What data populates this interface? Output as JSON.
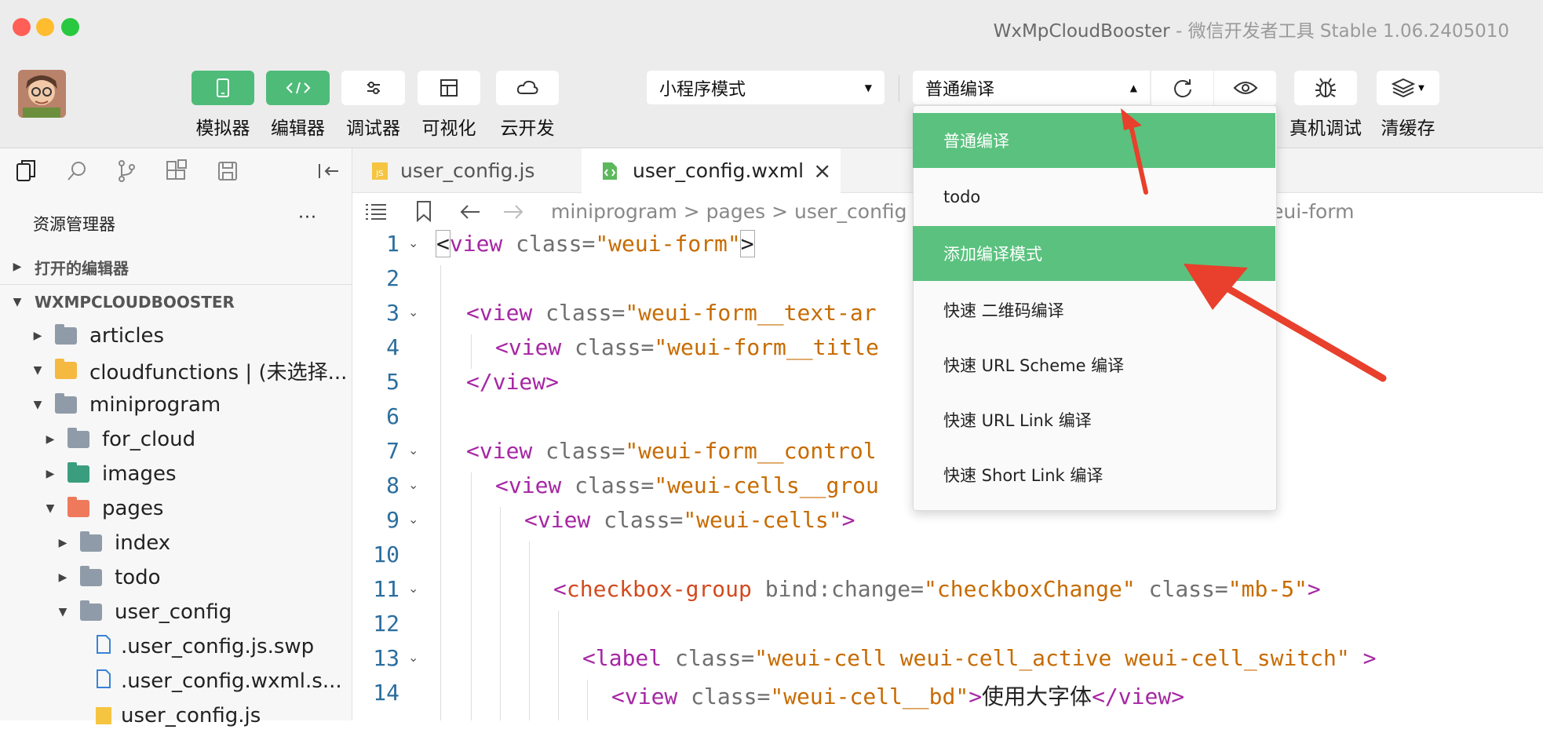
{
  "window": {
    "title": "WxMpCloudBooster",
    "subtitle": "微信开发者工具 Stable 1.06.2405010",
    "separator": "-"
  },
  "toolbar": {
    "buttons": [
      {
        "label": "模拟器",
        "icon": "phone-icon"
      },
      {
        "label": "编辑器",
        "icon": "code-icon"
      },
      {
        "label": "调试器",
        "icon": "sliders-icon"
      },
      {
        "label": "可视化",
        "icon": "layout-icon"
      },
      {
        "label": "云开发",
        "icon": "cloud-icon"
      }
    ],
    "mode_select": "小程序模式",
    "compile_select": "普通编译",
    "right_buttons": [
      {
        "label": "真机调试",
        "icon": "bug-icon"
      },
      {
        "label": "清缓存",
        "icon": "layers-icon"
      }
    ]
  },
  "dropdown": {
    "items": [
      "普通编译",
      "todo",
      "添加编译模式",
      "快速 二维码编译",
      "快速 URL Scheme 编译",
      "快速 URL Link 编译",
      "快速 Short Link 编译"
    ],
    "highlighted": [
      0,
      2
    ]
  },
  "sidebar": {
    "panel_title": "资源管理器",
    "more": "···",
    "open_editors": "打开的编辑器",
    "project": "WXMPCLOUDBOOSTER",
    "tree": [
      {
        "label": "articles"
      },
      {
        "label": "cloudfunctions | (未选择..."
      },
      {
        "label": "miniprogram"
      },
      {
        "label": "for_cloud"
      },
      {
        "label": "images"
      },
      {
        "label": "pages"
      },
      {
        "label": "index"
      },
      {
        "label": "todo"
      },
      {
        "label": "user_config"
      },
      {
        "label": ".user_config.js.swp"
      },
      {
        "label": ".user_config.wxml.s..."
      },
      {
        "label": "user_config.js"
      }
    ]
  },
  "tabs": [
    {
      "label": "user_config.js",
      "badge": "JS"
    },
    {
      "label": "user_config.wxml",
      "close": "×"
    }
  ],
  "breadcrumb": {
    "parts": [
      "miniprogram",
      "pages",
      "user_config"
    ],
    "sep": ">",
    "tail": "eui-form"
  },
  "code": {
    "lines": [
      "1",
      "2",
      "3",
      "4",
      "5",
      "6",
      "7",
      "8",
      "9",
      "10",
      "11",
      "12",
      "13",
      "14"
    ],
    "l1": {
      "open": "<",
      "tag": "view",
      "attr": " class=",
      "val": "\"weui-form\"",
      "close": ">"
    },
    "l3": {
      "open": "<",
      "tag": "view",
      "attr": " class=",
      "val": "\"weui-form__text-ar"
    },
    "l4": {
      "open": "<",
      "tag": "view",
      "attr": " class=",
      "val": "\"weui-form__title"
    },
    "l5": {
      "text": "</view>"
    },
    "l7": {
      "open": "<",
      "tag": "view",
      "attr": " class=",
      "val": "\"weui-form__control"
    },
    "l8": {
      "open": "<",
      "tag": "view",
      "attr": " class=",
      "val": "\"weui-cells__grou",
      "close": "\">"
    },
    "l9": {
      "open": "<",
      "tag": "view",
      "attr": " class=",
      "val": "\"weui-cells\"",
      "close": ">"
    },
    "l11": {
      "open": "<",
      "tag": "checkbox-group",
      "attr": " bind:change=",
      "val": "\"checkboxChange\"",
      "attr2": " class=",
      "val2": "\"mb-5\"",
      "close": ">"
    },
    "l13": {
      "open": "<",
      "tag": "label",
      "attr": " class=",
      "val": "\"weui-cell weui-cell_active weui-cell_switch\"",
      "close": " >"
    },
    "l14": {
      "open": "<",
      "tag": "view",
      "attr": " class=",
      "val": "\"weui-cell__bd\"",
      "close": ">",
      "text": "使用大字体",
      "end": "</view>"
    }
  },
  "colors": {
    "green": "#4fbb79",
    "highlight": "#5ac27e",
    "arrow": "#e8402c"
  }
}
